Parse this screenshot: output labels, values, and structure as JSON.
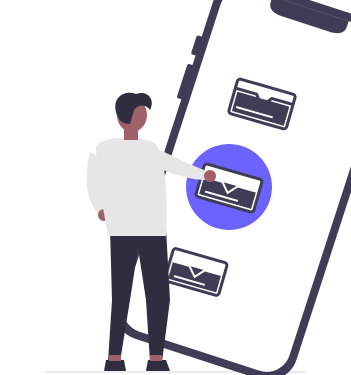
{
  "illustration": {
    "subject": "person-selecting-message-on-phone",
    "colors": {
      "phone_frame": "#3f3d56",
      "phone_screen": "#ffffff",
      "accent": "#6c63ff",
      "envelope_fill": "#ffffff",
      "envelope_stroke": "#3f3d56",
      "shirt": "#e6e6e6",
      "pants": "#2f2e41",
      "hair": "#2f2e41",
      "skin": "#a0616a",
      "shoes": "#2f2e41",
      "ground": "#e6e6e6",
      "leaf": "#f2f2f2"
    },
    "icons": [
      "envelope-icon",
      "envelope-icon",
      "envelope-icon"
    ]
  }
}
